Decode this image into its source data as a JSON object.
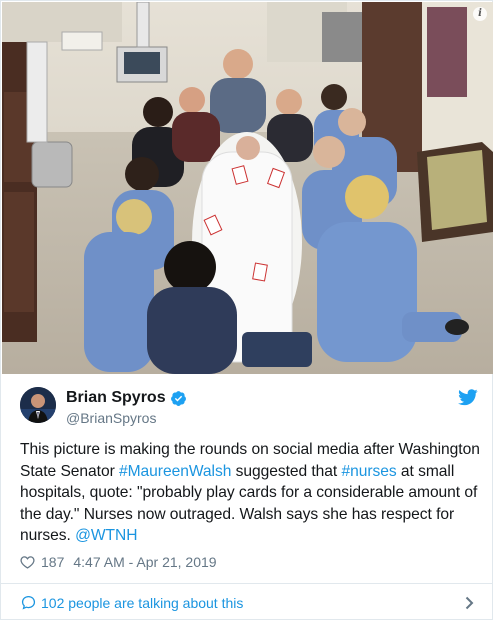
{
  "tweet": {
    "author": {
      "display_name": "Brian Spyros",
      "handle": "@BrianSpyros",
      "verified": true,
      "avatar_icon": "avatar-photo"
    },
    "text_parts": {
      "p1": "This picture is making the rounds on social media after Washington State Senator ",
      "link1": "#MaureenWalsh",
      "p2": " suggested that ",
      "link2": "#nurses",
      "p3": " at small hospitals, quote: \"probably play cards for a considerable amount of the day.\" Nurses now outraged. Walsh says she has respect for nurses. ",
      "link3": "@WTNH"
    },
    "likes": "187",
    "timestamp": "4:47 AM - Apr 21, 2019",
    "conversation_label": "102 people are talking about this"
  },
  "photo": {
    "description_icon": "info-icon",
    "info_glyph": "i"
  },
  "colors": {
    "link": "#1b95e0",
    "verified": "#1da1f2",
    "muted": "#657786",
    "scrubs": "#6f90c8"
  },
  "icons": [
    "verified-icon",
    "twitter-bird-icon",
    "heart-icon",
    "bubble-icon",
    "chevron-right-icon",
    "info-icon"
  ]
}
